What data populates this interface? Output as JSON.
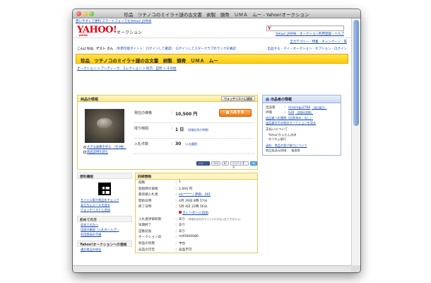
{
  "window": {
    "title": "珍品　ツチノコのミイラ＋謎の古文書　剥製　頭骨　ＵＭＡ　ムー - Yahoo!オークション"
  },
  "topnote": {
    "left": "使いやすくて便利 スマートフォンでもYahoo! JAPAN",
    "right": ""
  },
  "header": {
    "logo": "YAHOO!",
    "logo_sub": "JAPAN",
    "service": "オークション",
    "search_y": "Y",
    "links": "Yahoo! JAPAN - オークション利用登録 - ヘルプ"
  },
  "subnav": {
    "links": "全カテゴリー - 特集 - キャンペーン - 質"
  },
  "userbar": {
    "greeting": "こんにちは、ゲスト さん",
    "points": "（利用可能ポイント：ログインして確認）",
    "star": "ログインしてスタークラブのランクを確認",
    "right": "出品する - マイ・オークション - オプション - ログイン"
  },
  "listing": {
    "title": "珍品　ツチノコのミイラ＋謎の古文書　剥製　頭骨　ＵＭＡ　ムー"
  },
  "crumbs": "オークション > アンティーク、コレクション > 科学、自然 > その他",
  "item_panel": {
    "heading": "商品の情報",
    "watchlist_btn": "ウォッチリストに追加",
    "photo_links": [
      "大きな画像を見る （全3枚）",
      "商品説明を読む"
    ],
    "price_label": "現在の価格",
    "price_value": "10,500 円",
    "bid_btn": "入札する",
    "time_label": "残り時間",
    "time_value": "1 日",
    "time_note": "（詳細な残り時間）",
    "bids_label": "入札件数",
    "bids_value": "30",
    "bids_note": "（入札履歴）",
    "share": {
      "fb": "いいね！",
      "fb_count": "214",
      "hatena": "B!",
      "tweet": "ツイートする",
      "tw": "tw"
    }
  },
  "util": {
    "heading": "便利機能",
    "items": [
      "モバイル版で商品をチェック",
      "友だちにメールを送る",
      "ウォッチリストに追加"
    ],
    "beginners_heading": "初めての方",
    "beginners": [
      "初めての方へ",
      "用語の解説（入札のヘルプ）",
      "利用登録の手順"
    ],
    "contact_heading": "Yahoo!オークションへの連絡",
    "contact": [
      "違反商品の申告"
    ]
  },
  "details": {
    "heading": "詳細情報",
    "rows": [
      {
        "k": "個数",
        "v": "1"
      },
      {
        "k": "開始時の価格",
        "v": "2,000 円"
      },
      {
        "k": "最高額入札者",
        "v": "elc***** / 評価：281"
      },
      {
        "k": "開始日時",
        "v": "4月 29日 8時 57分"
      },
      {
        "k": "終了日時",
        "v": "5月 4日 22時 56分"
      },
      {
        "k": "",
        "v": "カレンダーに追加"
      },
      {
        "k": "入札者評価制限",
        "v": "あり",
        "small": "（評価の合計がマイナスの方は入札できません）"
      },
      {
        "k": "早期終了",
        "v": "あり"
      },
      {
        "k": "自動延長",
        "v": "あり"
      },
      {
        "k": "オークションID",
        "v": "m95600086"
      },
      {
        "k": "商品の状態",
        "v": "中古"
      },
      {
        "k": "返品の可否",
        "v": "返品不可"
      }
    ]
  },
  "seller": {
    "heading": "出品者の情報",
    "seller_label": "出品者",
    "seller_id": "missingu2780",
    "seller_note": "（自己紹介）",
    "rating_label": "評価",
    "rating_value": "630",
    "rating_note": "（評価の詳細）",
    "links": [
      "出品者への質問（回答済み：なし）",
      "出品者のその他のオークションを見る"
    ],
    "pay_head": "支払いについて",
    "pay_items": [
      "Yahoo!かんたん決済",
      "ゆうちょ銀行"
    ],
    "ship": "送料、商品の受け取りについて",
    "ship_region": "商品発送元地域 ： 福島県"
  }
}
